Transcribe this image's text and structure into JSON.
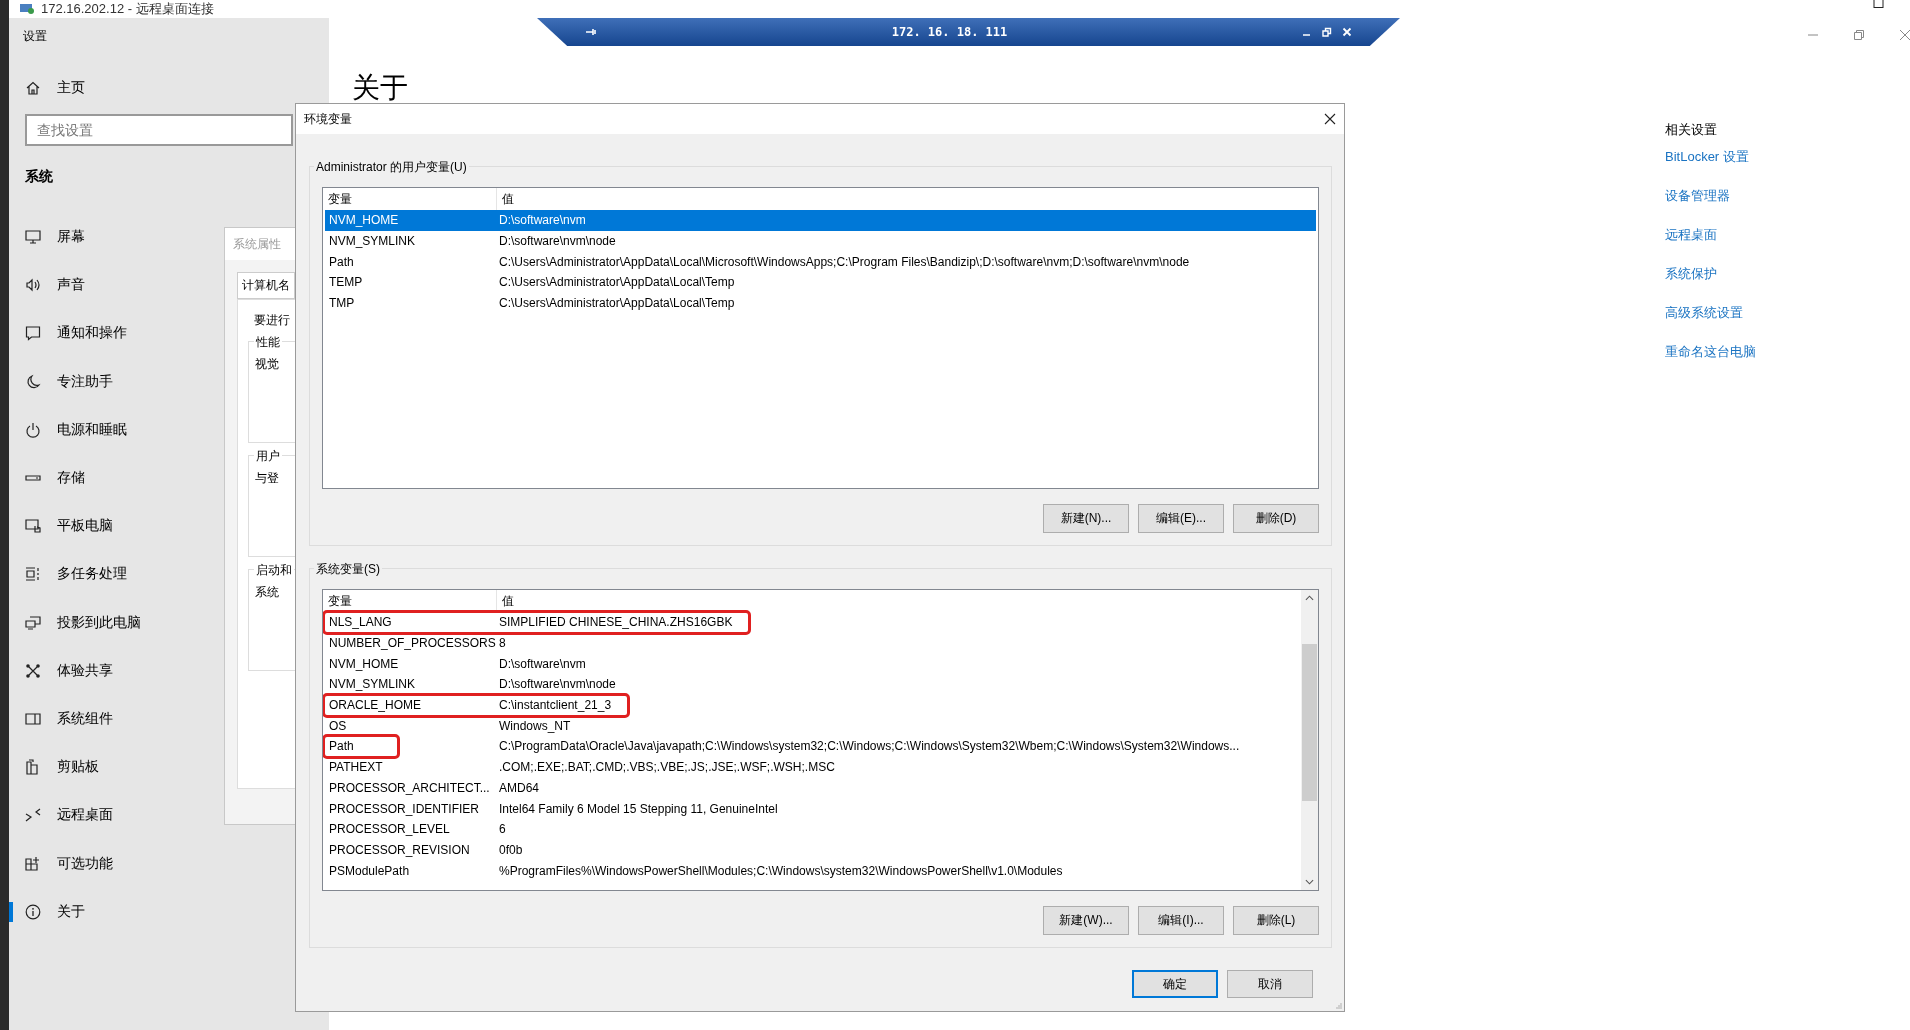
{
  "rdp_window": {
    "title": "172.16.202.12 - 远程桌面连接"
  },
  "connection_bar": {
    "host": "172. 16. 18. 111"
  },
  "settings": {
    "title": "设置",
    "home": "主页",
    "search": {
      "placeholder": "查找设置"
    },
    "section": "系统",
    "nav": [
      {
        "label": "屏幕",
        "selected": false
      },
      {
        "label": "声音",
        "selected": false
      },
      {
        "label": "通知和操作",
        "selected": false
      },
      {
        "label": "专注助手",
        "selected": false
      },
      {
        "label": "电源和睡眠",
        "selected": false
      },
      {
        "label": "存储",
        "selected": false
      },
      {
        "label": "平板电脑",
        "selected": false
      },
      {
        "label": "多任务处理",
        "selected": false
      },
      {
        "label": "投影到此电脑",
        "selected": false
      },
      {
        "label": "体验共享",
        "selected": false
      },
      {
        "label": "系统组件",
        "selected": false
      },
      {
        "label": "剪贴板",
        "selected": false
      },
      {
        "label": "远程桌面",
        "selected": false
      },
      {
        "label": "可选功能",
        "selected": false
      },
      {
        "label": "关于",
        "selected": true
      }
    ]
  },
  "page": {
    "heading": "关于",
    "related_title": "相关设置",
    "related_links": [
      "BitLocker 设置",
      "设备管理器",
      "远程桌面",
      "系统保护",
      "高级系统设置",
      "重命名这台电脑"
    ]
  },
  "system_properties": {
    "title": "系统属性",
    "tab": "计算机名",
    "intro": "要进行",
    "groups": [
      {
        "label": "性能",
        "text": "视觉"
      },
      {
        "label": "用户",
        "text": "与登"
      },
      {
        "label": "启动和",
        "text": "系统"
      }
    ]
  },
  "dialog": {
    "title": "环境变量",
    "user_vars": {
      "label": "Administrator 的用户变量(U)",
      "columns": [
        "变量",
        "值"
      ],
      "rows": [
        {
          "name": "NVM_HOME",
          "value": "D:\\software\\nvm",
          "selected": true
        },
        {
          "name": "NVM_SYMLINK",
          "value": "D:\\software\\nvm\\node",
          "selected": false
        },
        {
          "name": "Path",
          "value": "C:\\Users\\Administrator\\AppData\\Local\\Microsoft\\WindowsApps;C:\\Program Files\\Bandizip\\;D:\\software\\nvm;D:\\software\\nvm\\node",
          "selected": false
        },
        {
          "name": "TEMP",
          "value": "C:\\Users\\Administrator\\AppData\\Local\\Temp",
          "selected": false
        },
        {
          "name": "TMP",
          "value": "C:\\Users\\Administrator\\AppData\\Local\\Temp",
          "selected": false
        }
      ],
      "buttons": [
        "新建(N)...",
        "编辑(E)...",
        "删除(D)"
      ]
    },
    "system_vars": {
      "label": "系统变量(S)",
      "columns": [
        "变量",
        "值"
      ],
      "rows": [
        {
          "name": "NLS_LANG",
          "value": "SIMPLIFIED CHINESE_CHINA.ZHS16GBK",
          "selected": false,
          "name_highlighted": true,
          "value_highlighted": true
        },
        {
          "name": "NUMBER_OF_PROCESSORS",
          "value": "8",
          "selected": false,
          "name_highlighted": false,
          "value_highlighted": false
        },
        {
          "name": "NVM_HOME",
          "value": "D:\\software\\nvm",
          "selected": false,
          "name_highlighted": false,
          "value_highlighted": false
        },
        {
          "name": "NVM_SYMLINK",
          "value": "D:\\software\\nvm\\node",
          "selected": false,
          "name_highlighted": false,
          "value_highlighted": false
        },
        {
          "name": "ORACLE_HOME",
          "value": "C:\\instantclient_21_3",
          "selected": false,
          "name_highlighted": true,
          "value_highlighted": true
        },
        {
          "name": "OS",
          "value": "Windows_NT",
          "selected": false,
          "name_highlighted": false,
          "value_highlighted": false
        },
        {
          "name": "Path",
          "value": "C:\\ProgramData\\Oracle\\Java\\javapath;C:\\Windows\\system32;C:\\Windows;C:\\Windows\\System32\\Wbem;C:\\Windows\\System32\\Windows...",
          "selected": false,
          "name_highlighted": true,
          "value_highlighted": false
        },
        {
          "name": "PATHEXT",
          "value": ".COM;.EXE;.BAT;.CMD;.VBS;.VBE;.JS;.JSE;.WSF;.WSH;.MSC",
          "selected": false,
          "name_highlighted": false,
          "value_highlighted": false
        },
        {
          "name": "PROCESSOR_ARCHITECT...",
          "value": "AMD64",
          "selected": false,
          "name_highlighted": false,
          "value_highlighted": false
        },
        {
          "name": "PROCESSOR_IDENTIFIER",
          "value": "Intel64 Family 6 Model 15 Stepping 11, GenuineIntel",
          "selected": false,
          "name_highlighted": false,
          "value_highlighted": false
        },
        {
          "name": "PROCESSOR_LEVEL",
          "value": "6",
          "selected": false,
          "name_highlighted": false,
          "value_highlighted": false
        },
        {
          "name": "PROCESSOR_REVISION",
          "value": "0f0b",
          "selected": false,
          "name_highlighted": false,
          "value_highlighted": false
        },
        {
          "name": "PSModulePath",
          "value": "%ProgramFiles%\\WindowsPowerShell\\Modules;C:\\Windows\\system32\\WindowsPowerShell\\v1.0\\Modules",
          "selected": false,
          "name_highlighted": false,
          "value_highlighted": false
        }
      ],
      "buttons": [
        "新建(W)...",
        "编辑(I)...",
        "删除(L)"
      ]
    },
    "ok": "确定",
    "cancel": "取消"
  }
}
